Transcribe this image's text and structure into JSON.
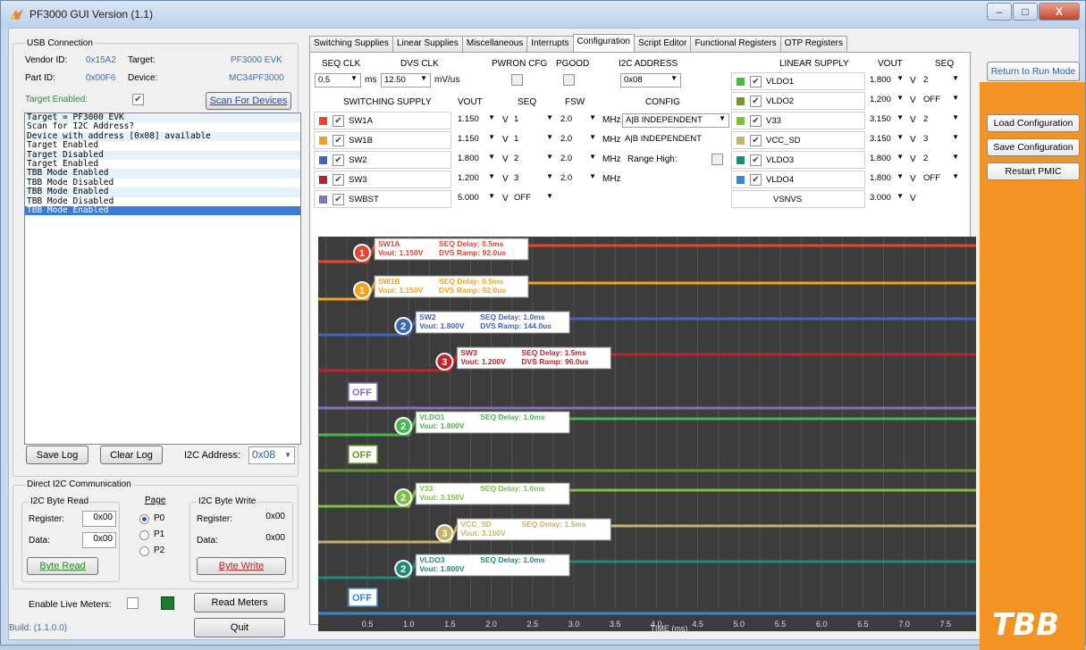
{
  "window": {
    "title": "PF3000 GUI Version (1.1)",
    "min": "–",
    "max": "□",
    "close": "X"
  },
  "usb": {
    "group": "USB Connection",
    "vendor_label": "Vendor ID:",
    "vendor_val": "0x15A2",
    "target_label": "Target:",
    "target_val": "PF3000 EVK",
    "part_label": "Part ID:",
    "part_val": "0x00F6",
    "device_label": "Device:",
    "device_val": "MC34PF3000",
    "target_enabled": "Target Enabled:",
    "scan": "Scan For Devices"
  },
  "log": [
    "Target = PF3000 EVK",
    "Scan for I2C Address?",
    "Device with address [0x08] available",
    "Target Enabled",
    "Target Disabled",
    "Target Enabled",
    "TBB Mode Enabled",
    "TBB Mode Disabled",
    "TBB Mode Enabled",
    "TBB Mode Disabled",
    "TBB Mode Enabled"
  ],
  "logctl": {
    "save": "Save Log",
    "clear": "Clear Log",
    "i2c_label": "I2C Address:",
    "i2c_val": "0x08"
  },
  "direct": {
    "group": "Direct I2C Communication",
    "read_group": "I2C Byte Read",
    "page": "Page",
    "write_group": "I2C Byte Write",
    "register": "Register:",
    "data": "Data:",
    "r_reg": "0x00",
    "r_data": "0x00",
    "w_reg": "0x00",
    "w_data": "0x00",
    "p0": "P0",
    "p1": "P1",
    "p2": "P2",
    "byte_read": "Byte Read",
    "byte_write": "Byte Write"
  },
  "bottom": {
    "live": "Enable Live Meters:",
    "read_meters": "Read Meters",
    "quit": "Quit",
    "build": "Build: (1.1.0.0)"
  },
  "tabs": [
    "Switching Supplies",
    "Linear Supplies",
    "Miscellaneous",
    "Interrupts",
    "Configuration",
    "Script Editor",
    "Functional Registers",
    "OTP Registers"
  ],
  "config": {
    "seqclk": "SEQ CLK",
    "seqclk_val": "0.5",
    "ms": "ms",
    "dvsclk": "DVS CLK",
    "dvsclk_val": "12.50",
    "mvus": "mV/us",
    "pwron": "PWRON CFG",
    "pgood": "PGOOD",
    "i2c_addr": "I2C ADDRESS",
    "i2c_addr_val": "0x08",
    "sw_hdr": [
      "SWITCHING SUPPLY",
      "VOUT",
      "SEQ",
      "FSW",
      "CONFIG"
    ],
    "switching": [
      {
        "name": "SW1A",
        "color": "#e8452c",
        "vout": "1.150",
        "seq": "1",
        "fsw": "2.0",
        "config": "A|B INDEPENDENT"
      },
      {
        "name": "SW1B",
        "color": "#f3a31b",
        "vout": "1.150",
        "seq": "1",
        "fsw": "2.0",
        "config": "A|B INDEPENDENT"
      },
      {
        "name": "SW2",
        "color": "#3e66b8",
        "vout": "1.800",
        "seq": "2",
        "fsw": "2.0",
        "config": ""
      },
      {
        "name": "SW3",
        "color": "#b81f26",
        "vout": "1.200",
        "seq": "3",
        "fsw": "2.0",
        "config": ""
      },
      {
        "name": "SWBST",
        "color": "#8a6fc1",
        "vout": "5.000",
        "seq": "OFF",
        "fsw": "",
        "config": ""
      }
    ],
    "v": "V",
    "mhz": "MHz",
    "range_high": "Range High:",
    "lin_hdr": [
      "LINEAR SUPPLY",
      "VOUT",
      "SEQ"
    ],
    "linear": [
      {
        "name": "VLDO1",
        "color": "#49b84a",
        "vout": "1.800",
        "seq": "2"
      },
      {
        "name": "VLDO2",
        "color": "#6a9a2c",
        "vout": "1.200",
        "seq": "OFF"
      },
      {
        "name": "V33",
        "color": "#7cc242",
        "vout": "3.150",
        "seq": "2"
      },
      {
        "name": "VCC_SD",
        "color": "#c3b46a",
        "vout": "3.150",
        "seq": "3"
      },
      {
        "name": "VLDO3",
        "color": "#1e8a7a",
        "vout": "1.800",
        "seq": "2"
      },
      {
        "name": "VLDO4",
        "color": "#3a86d0",
        "vout": "1.800",
        "seq": "OFF"
      },
      {
        "name": "VSNVS",
        "color": "",
        "vout": "3.000",
        "seq": ""
      }
    ]
  },
  "side": {
    "return": "Return to Run Mode",
    "load": "Load Configuration",
    "save": "Save Configuration",
    "restart": "Restart PMIC",
    "logo": "TBB"
  },
  "timing": {
    "xlabel": "TIME (ms)",
    "ticks": [
      "0.5",
      "1.0",
      "1.5",
      "2.0",
      "2.5",
      "3.0",
      "3.5",
      "4.0",
      "4.5",
      "5.0",
      "5.5",
      "6.0",
      "6.5",
      "7.0",
      "7.5"
    ],
    "rails": [
      {
        "name": "SW1A",
        "color": "#e8452c",
        "order": "1",
        "start": 0.5,
        "vout": "Vout: 1.150V",
        "delay": "SEQ Delay: 0.5ms",
        "ramp": "DVS Ramp: 92.0us"
      },
      {
        "name": "SW1B",
        "color": "#f3a31b",
        "order": "1",
        "start": 0.5,
        "vout": "Vout: 1.150V",
        "delay": "SEQ Delay: 0.5ms",
        "ramp": "DVS Ramp: 92.0us"
      },
      {
        "name": "SW2",
        "color": "#3e66b8",
        "order": "2",
        "start": 1.0,
        "vout": "Vout: 1.800V",
        "delay": "SEQ Delay: 1.0ms",
        "ramp": "DVS Ramp: 144.0us"
      },
      {
        "name": "SW3",
        "color": "#c0242b",
        "order": "3",
        "start": 1.5,
        "vout": "Vout: 1.200V",
        "delay": "SEQ Delay: 1.5ms",
        "ramp": "DVS Ramp: 96.0us"
      },
      {
        "name": "SWBST",
        "color": "#8a6fc1",
        "order": "OFF",
        "start": null,
        "vout": "",
        "delay": "",
        "ramp": ""
      },
      {
        "name": "VLDO1",
        "color": "#49b84a",
        "order": "2",
        "start": 1.0,
        "vout": "Vout: 1.800V",
        "delay": "SEQ Delay: 1.0ms",
        "ramp": ""
      },
      {
        "name": "VLDO2",
        "color": "#6a9a2c",
        "order": "OFF",
        "start": null,
        "vout": "",
        "delay": "",
        "ramp": ""
      },
      {
        "name": "V33",
        "color": "#7cc242",
        "order": "2",
        "start": 1.0,
        "vout": "Vout: 3.150V",
        "delay": "SEQ Delay: 1.0ms",
        "ramp": ""
      },
      {
        "name": "VCC_SD",
        "color": "#c3b46a",
        "order": "3",
        "start": 1.5,
        "vout": "Vout: 3.150V",
        "delay": "SEQ Delay: 1.5ms",
        "ramp": ""
      },
      {
        "name": "VLDO3",
        "color": "#1e8a7a",
        "order": "2",
        "start": 1.0,
        "vout": "Vout: 1.800V",
        "delay": "SEQ Delay: 1.0ms",
        "ramp": ""
      },
      {
        "name": "VLDO4",
        "color": "#3a86d0",
        "order": "OFF",
        "start": null,
        "vout": "",
        "delay": "",
        "ramp": ""
      }
    ]
  }
}
